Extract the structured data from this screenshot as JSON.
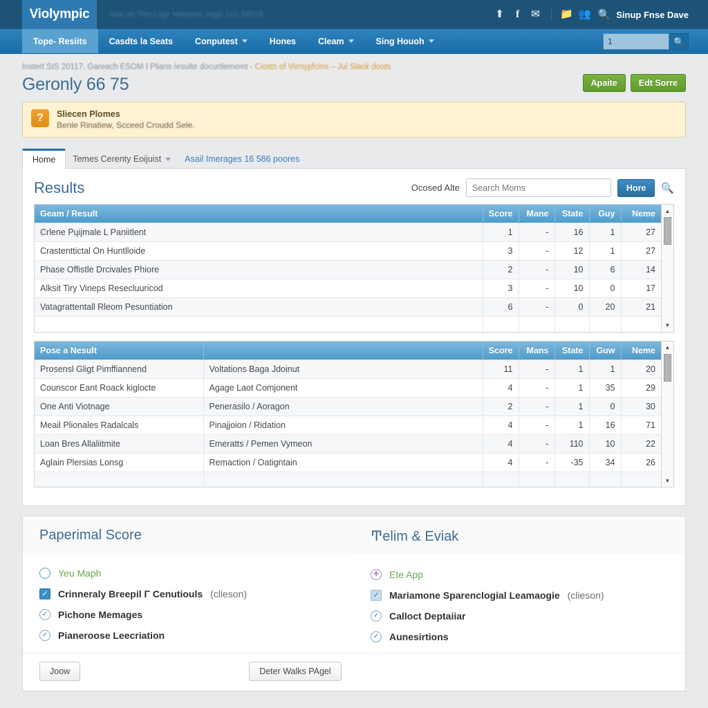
{
  "topbar": {
    "brand": "Violympic",
    "tagline": "Stat on Tho Lugr Hdeplne Jego 113 39019",
    "icons": [
      "upload-icon",
      "facebook-icon",
      "mail-icon",
      "folder-icon",
      "people-icon"
    ],
    "search_icon": "search-icon",
    "user_label": "Sinup Fnse Dave"
  },
  "nav": {
    "items": [
      {
        "label": "Tope- Resiits",
        "caret": false,
        "active": true
      },
      {
        "label": "Casdts la Seats",
        "caret": false,
        "active": false
      },
      {
        "label": "Conputest",
        "caret": true,
        "active": false
      },
      {
        "label": "Hones",
        "caret": false,
        "active": false
      },
      {
        "label": "Cleam",
        "caret": true,
        "active": false
      },
      {
        "label": "Sing Houoh",
        "caret": true,
        "active": false
      }
    ],
    "search_value": "1",
    "search_placeholder": "1",
    "search_button_icon": "search-icon"
  },
  "breadcrumb": {
    "plain": "Instert SIS 20117. Gareach ESOM I Plians /esulte docurtlememt - ",
    "link": "Ciosts of Viirnypfcins – Jui Slack doots"
  },
  "header": {
    "title": "Geronly 66 75",
    "actions": [
      {
        "label": "Apaite"
      },
      {
        "label": "Edt Sorre"
      }
    ]
  },
  "alert": {
    "icon": "?",
    "title": "Sliecen Plomes",
    "text": "Benle Rinatiew, Scceed Croudd Sele."
  },
  "tabs": {
    "active": "Home",
    "links": [
      {
        "label": "Temes Cerenty Eoijuist",
        "caret": true,
        "blue": false
      },
      {
        "label": "Asail Imerages 16 586 poores",
        "caret": false,
        "blue": true
      }
    ]
  },
  "panel": {
    "title": "Results",
    "search_label": "Ocosed Alte",
    "search_placeholder": "Search Moms",
    "search_value": "",
    "search_button": "Hore",
    "search_icon": "search-icon"
  },
  "table1": {
    "columns": [
      "Geam / Result",
      "Score",
      "Mane",
      "State",
      "Guy",
      "Neme"
    ],
    "rows": [
      {
        "name": "Crlene Pųĳmale L Paniitlent",
        "score": "1",
        "mane": "-",
        "state": "16",
        "guy": "1",
        "neme": "27"
      },
      {
        "name": "Crastenttictal On Huntlloide",
        "score": "3",
        "mane": "-",
        "state": "12",
        "guy": "1",
        "neme": "27"
      },
      {
        "name": "Phase Offistle Drcivales Phiore",
        "score": "2",
        "mane": "-",
        "state": "10",
        "guy": "6",
        "neme": "14"
      },
      {
        "name": "Alksit Tiry Vineps Resecluuricod",
        "score": "3",
        "mane": "-",
        "state": "10",
        "guy": "0",
        "neme": "17"
      },
      {
        "name": "Vatagrattentall Rleom Pesuntiation",
        "score": "6",
        "mane": "-",
        "state": "0",
        "guy": "20",
        "neme": "21"
      }
    ]
  },
  "table2": {
    "columns": [
      "Pose a Nesult",
      "",
      "Score",
      "Mans",
      "State",
      "Guw",
      "Neme"
    ],
    "rows": [
      {
        "name": "Prosensl Gligt Pimffiannend",
        "detail": "Voltations Baga Jdoinut",
        "score": "11",
        "mane": "-",
        "state": "1",
        "guy": "1",
        "neme": "20"
      },
      {
        "name": "Counscor Eant Roack kiglocte",
        "detail": "Agage Laot Comjonent",
        "score": "4",
        "mane": "-",
        "state": "1",
        "guy": "35",
        "neme": "29"
      },
      {
        "name": "One Anti Viotnage",
        "detail": "Penerasilo / Aoragon",
        "score": "2",
        "mane": "-",
        "state": "1",
        "guy": "0",
        "neme": "30"
      },
      {
        "name": "Meail Plionales Radalcals",
        "detail": "Pinajjoion / Ridation",
        "score": "4",
        "mane": "-",
        "state": "1",
        "guy": "16",
        "neme": "71"
      },
      {
        "name": "Loan Bres Allaliitmite",
        "detail": "Emeratts / Pemen Vymeon",
        "score": "4",
        "mane": "-",
        "state": "110",
        "guy": "10",
        "neme": "22"
      },
      {
        "name": "Aglain Plersias Lonsg",
        "detail": "Remaction / Oatigntain",
        "score": "4",
        "mane": "-",
        "state": "-35",
        "guy": "34",
        "neme": "26"
      }
    ]
  },
  "bottom": {
    "left": {
      "heading": "Paperimal Score",
      "items": [
        {
          "icon": "ring-teal-icon",
          "label": "Yeu Maph",
          "style": "green",
          "suffix": ""
        },
        {
          "icon": "checkbox-filled-icon",
          "label": "Crinneraly Breepil Γ Cenutiouls",
          "style": "strong",
          "suffix": "(clieson)"
        },
        {
          "icon": "check-circle-icon",
          "label": "Pichone Memages",
          "style": "strong",
          "suffix": ""
        },
        {
          "icon": "check-circle-icon",
          "label": "Pianeroose Leecriation",
          "style": "strong",
          "suffix": ""
        }
      ]
    },
    "right": {
      "heading": "Ͳelim & Eviak",
      "items": [
        {
          "icon": "ring-purple-icon",
          "label": "Ete App",
          "style": "green",
          "suffix": ""
        },
        {
          "icon": "checkbox-pale-icon",
          "label": "Mariamonе Sparenclogial Leamaogie",
          "style": "strong",
          "suffix": "(clieson)"
        },
        {
          "icon": "check-circle-icon",
          "label": "Calloct Deptaiiar",
          "style": "strong",
          "suffix": ""
        },
        {
          "icon": "check-circle-icon",
          "label": "Aunesirtions",
          "style": "strong",
          "suffix": ""
        }
      ]
    },
    "footer": {
      "left_button": "Joow",
      "right_button": "Deter Walks PAgel"
    }
  },
  "colors": {
    "topbar": "#1d5377",
    "navbar": "#2277b2",
    "brand_bg": "#2e7ab0",
    "heading": "#3b6c94",
    "green_button": "#5f9c2b",
    "blue_button": "#2a6f9f",
    "alert_bg": "#fdf3d4",
    "table_header": "#4e9bca"
  }
}
